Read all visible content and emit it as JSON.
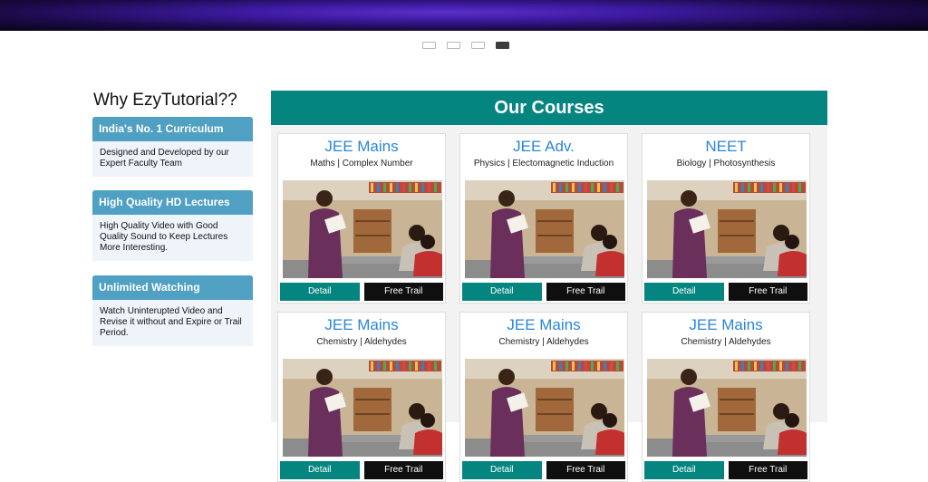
{
  "carousel": {
    "slide_count": 4,
    "active_index": 3
  },
  "why": {
    "title": "Why EzyTutorial??",
    "features": [
      {
        "title": "India's No. 1 Curriculum",
        "text": "Designed and Developed by our Expert Faculty Team"
      },
      {
        "title": "High Quality HD Lectures",
        "text": "High Quality Video with Good Quality Sound to Keep Lectures More Interesting."
      },
      {
        "title": "Unlimited Watching",
        "text": "Watch Uninterupted Video and Revise it without and Expire or Trail Period."
      }
    ]
  },
  "courses": {
    "heading": "Our Courses",
    "detail_label": "Detail",
    "trial_label": "Free Trail",
    "items": [
      {
        "title": "JEE Mains",
        "subtitle": "Maths | Complex Number"
      },
      {
        "title": "JEE Adv.",
        "subtitle": "Physics | Electomagnetic Induction"
      },
      {
        "title": "NEET",
        "subtitle": "Biology | Photosynthesis"
      },
      {
        "title": "JEE Mains",
        "subtitle": "Chemistry | Aldehydes"
      },
      {
        "title": "JEE Mains",
        "subtitle": "Chemistry | Aldehydes"
      },
      {
        "title": "JEE Mains",
        "subtitle": "Chemistry | Aldehydes"
      }
    ]
  },
  "colors": {
    "teal": "#058580",
    "feature_blue": "#4fa0c2",
    "title_blue": "#2a86d6"
  }
}
